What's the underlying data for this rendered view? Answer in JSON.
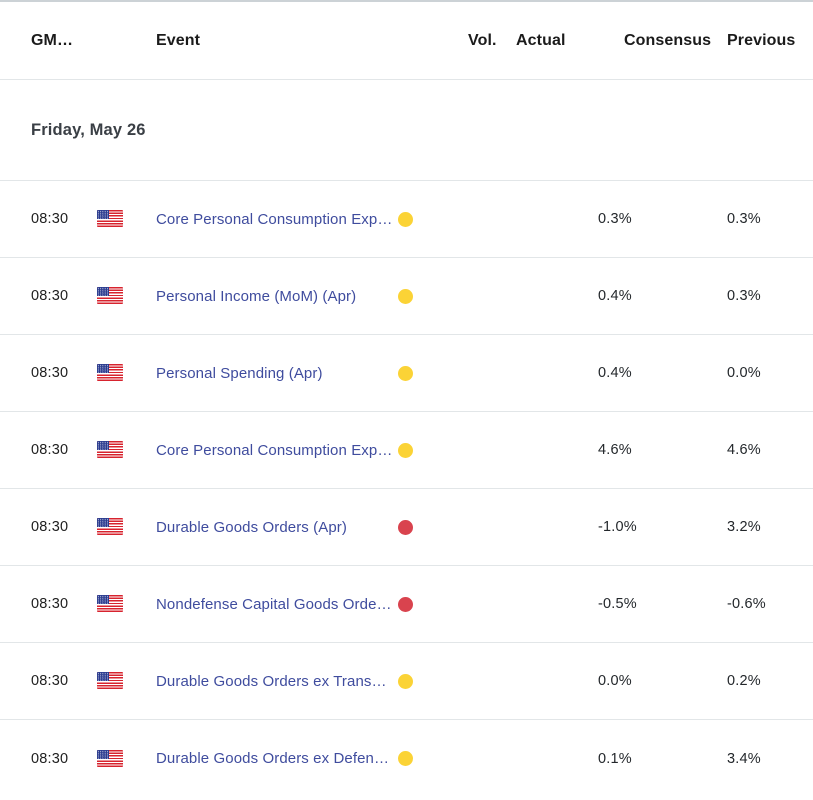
{
  "table": {
    "columns": [
      {
        "key": "time",
        "label": "GM…"
      },
      {
        "key": "event",
        "label": "Event"
      },
      {
        "key": "vol",
        "label": "Vol."
      },
      {
        "key": "actual",
        "label": "Actual"
      },
      {
        "key": "consensus",
        "label": "Consensus"
      },
      {
        "key": "previous",
        "label": "Previous"
      }
    ],
    "date_group": "Friday, May 26",
    "rows": [
      {
        "time": "08:30",
        "country_icon": "us-flag-icon",
        "event": "Core Personal Consumption Expenditur…",
        "volatility": "moderate",
        "volatility_icon": "yellow-dot-icon",
        "actual": "",
        "consensus": "0.3%",
        "previous": "0.3%"
      },
      {
        "time": "08:30",
        "country_icon": "us-flag-icon",
        "event": "Personal Income (MoM) (Apr)",
        "volatility": "moderate",
        "volatility_icon": "yellow-dot-icon",
        "actual": "",
        "consensus": "0.4%",
        "previous": "0.3%"
      },
      {
        "time": "08:30",
        "country_icon": "us-flag-icon",
        "event": "Personal Spending (Apr)",
        "volatility": "moderate",
        "volatility_icon": "yellow-dot-icon",
        "actual": "",
        "consensus": "0.4%",
        "previous": "0.0%"
      },
      {
        "time": "08:30",
        "country_icon": "us-flag-icon",
        "event": "Core Personal Consumption Expenditur…",
        "volatility": "moderate",
        "volatility_icon": "yellow-dot-icon",
        "actual": "",
        "consensus": "4.6%",
        "previous": "4.6%"
      },
      {
        "time": "08:30",
        "country_icon": "us-flag-icon",
        "event": "Durable Goods Orders (Apr)",
        "volatility": "high",
        "volatility_icon": "red-dot-icon",
        "actual": "",
        "consensus": "-1.0%",
        "previous": "3.2%"
      },
      {
        "time": "08:30",
        "country_icon": "us-flag-icon",
        "event": "Nondefense Capital Goods Orders ex Ai…",
        "volatility": "high",
        "volatility_icon": "red-dot-icon",
        "actual": "",
        "consensus": "-0.5%",
        "previous": "-0.6%"
      },
      {
        "time": "08:30",
        "country_icon": "us-flag-icon",
        "event": "Durable Goods Orders ex Transportatio…",
        "volatility": "moderate",
        "volatility_icon": "yellow-dot-icon",
        "actual": "",
        "consensus": "0.0%",
        "previous": "0.2%"
      },
      {
        "time": "08:30",
        "country_icon": "us-flag-icon",
        "event": "Durable Goods Orders ex Defense (Apr)",
        "volatility": "moderate",
        "volatility_icon": "yellow-dot-icon",
        "actual": "",
        "consensus": "0.1%",
        "previous": "3.4%"
      }
    ]
  },
  "colors": {
    "volatility_moderate": "#fbd336",
    "volatility_high": "#d9434e",
    "event_link": "#3f4c9e",
    "divider": "#e2e6e8",
    "text_primary": "#1e1e1e"
  }
}
